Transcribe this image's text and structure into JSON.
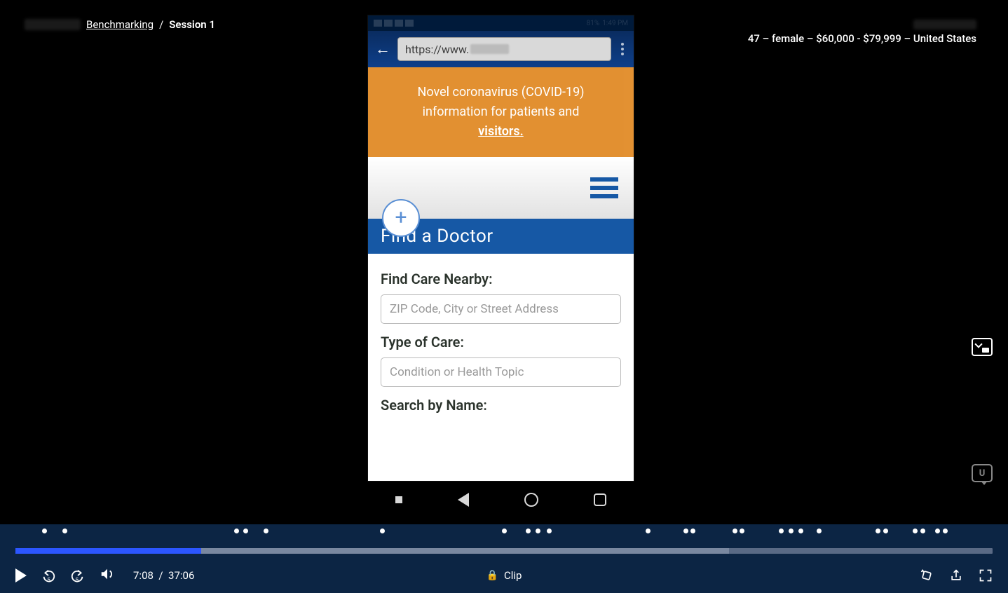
{
  "breadcrumb": {
    "link_label": "Benchmarking",
    "separator": "/",
    "current": "Session 1"
  },
  "participant": {
    "demographics": "47 – female – $60,000 - $79,999 – United States"
  },
  "phone": {
    "status_time": "1:49 PM",
    "status_battery": "81%",
    "url_prefix": "https://www.",
    "covid_line1": "Novel coronavirus (COVID-19)",
    "covid_line2": "information for patients and",
    "covid_link": "visitors.",
    "section_title": "Find a Doctor",
    "form": {
      "nearby_label": "Find Care Nearby:",
      "nearby_placeholder": "ZIP Code, City or Street Address",
      "type_label": "Type of Care:",
      "type_placeholder": "Condition or Health Topic",
      "name_label": "Search by Name:"
    }
  },
  "chat_badge": "U",
  "player": {
    "current_time": "7:08",
    "separator": "/",
    "total_time": "37:06",
    "clip_label": "Clip",
    "progress_percent": 19,
    "buffer_percent": 73,
    "markers_percent": [
      2.7,
      4.8,
      22.4,
      23.3,
      25.4,
      37.3,
      49.8,
      52.2,
      53.2,
      54.4,
      64.5,
      68.4,
      69.1,
      73.4,
      74.1,
      78.1,
      79.1,
      80.1,
      82.0,
      88.0,
      88.8,
      91.8,
      92.6,
      94.1,
      94.9
    ]
  }
}
